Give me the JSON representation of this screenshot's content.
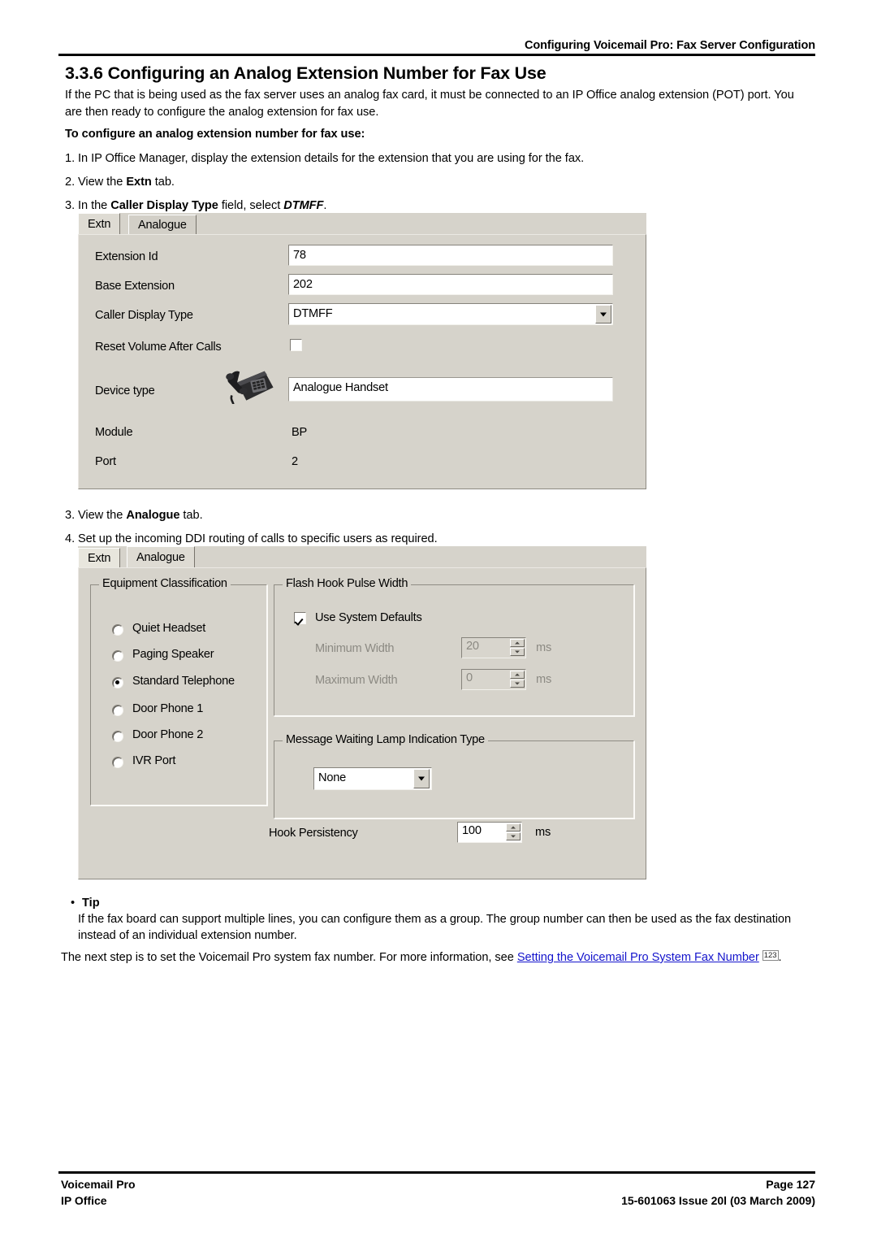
{
  "page": {
    "header_title": "Configuring Voicemail Pro: Fax Server Configuration",
    "section_title": "3.3.6 Configuring an Analog Extension Number for Fax Use",
    "intro": "If the PC that is being used as the fax server uses an analog fax card, it must be connected to an IP Office analog extension (POT) port. You are then ready to configure the analog extension for fax use.",
    "subhead": "To configure an analog extension number for fax use:",
    "steps": [
      {
        "num": "1.",
        "text_before": "In IP Office Manager, display the extension details for the extension that you are using for the fax.",
        "bold": "",
        "text_after": ""
      },
      {
        "num": "2.",
        "text_before": "View the ",
        "bold": "Extn",
        "text_after": " tab."
      },
      {
        "num": "3.",
        "text_before": "In the ",
        "bold": "Caller Display Type",
        "text_after": " field, select ",
        "bold_italic": "DTMFF",
        "text_end": "."
      },
      {
        "num": "3.",
        "text_before": "View the ",
        "bold": "Analogue",
        "text_after": " tab."
      },
      {
        "num": "4.",
        "text_before": "Set up the incoming DDI routing of calls to specific users as required.",
        "bold": "",
        "text_after": ""
      }
    ],
    "tip_label": "Tip",
    "tip_body": "If the fax board can support multiple lines, you can configure them as a group. The group number can then be used as the fax destination instead of an individual extension number.",
    "closing_before": "The next step is to set the Voicemail Pro system fax number. For more information, see ",
    "closing_link": "Setting the Voicemail Pro System Fax Number",
    "closing_pageref": "123",
    "closing_after": ".",
    "footer": {
      "left_line1": "Voicemail Pro",
      "left_line2": "IP Office",
      "right_line1": "Page 127",
      "right_line2": "15-601063 Issue 20l (03 March 2009)"
    }
  },
  "dialog_extn": {
    "tabs": [
      {
        "label": "Extn",
        "active": true
      },
      {
        "label": "Analogue",
        "active": false
      }
    ],
    "fields": {
      "extension_id_label": "Extension Id",
      "extension_id_value": "78",
      "base_extension_label": "Base Extension",
      "base_extension_value": "202",
      "caller_display_type_label": "Caller Display Type",
      "caller_display_type_value": "DTMFF",
      "reset_volume_label": "Reset Volume After Calls",
      "reset_volume_checked": false,
      "device_type_label": "Device type",
      "device_type_value": "Analogue Handset",
      "module_label": "Module",
      "module_value": "BP",
      "port_label": "Port",
      "port_value": "2"
    }
  },
  "dialog_analogue": {
    "tabs": [
      {
        "label": "Extn",
        "active": false
      },
      {
        "label": "Analogue",
        "active": true
      }
    ],
    "equipment_classification": {
      "title": "Equipment Classification",
      "options": [
        {
          "label": "Quiet Headset",
          "selected": false
        },
        {
          "label": "Paging Speaker",
          "selected": false
        },
        {
          "label": "Standard Telephone",
          "selected": true
        },
        {
          "label": "Door Phone 1",
          "selected": false
        },
        {
          "label": "Door Phone 2",
          "selected": false
        },
        {
          "label": "IVR Port",
          "selected": false
        }
      ]
    },
    "flash_hook": {
      "title": "Flash Hook Pulse Width",
      "use_system_defaults_label": "Use System Defaults",
      "use_system_defaults_checked": true,
      "minimum_width_label": "Minimum Width",
      "minimum_width_value": "20",
      "minimum_width_unit": "ms",
      "maximum_width_label": "Maximum Width",
      "maximum_width_value": "0",
      "maximum_width_unit": "ms"
    },
    "mwi": {
      "title": "Message Waiting Lamp Indication Type",
      "value": "None"
    },
    "hook_persistency": {
      "label": "Hook Persistency",
      "value": "100",
      "unit": "ms"
    }
  },
  "colors": {
    "dialog_bg": "#d6d3cb",
    "link": "#1414cc",
    "field_bg": "#ffffff",
    "disabled_text": "#8c8a83"
  }
}
